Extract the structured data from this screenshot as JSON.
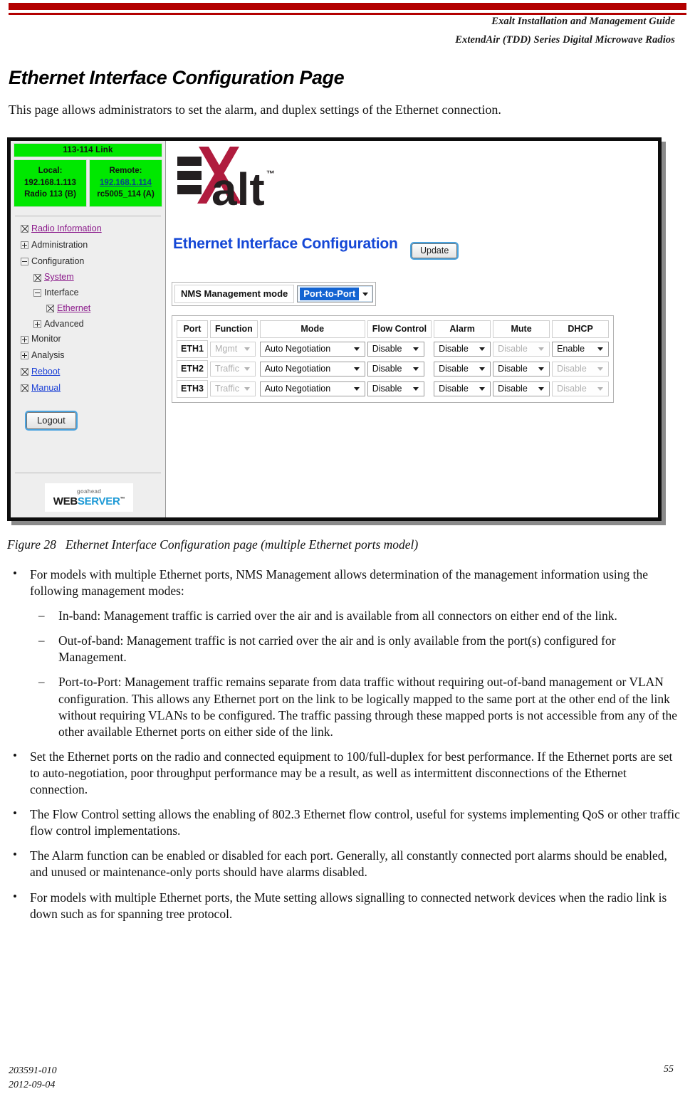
{
  "header": {
    "line1": "Exalt Installation and Management Guide",
    "line2": "ExtendAir (TDD) Series Digital Microwave Radios",
    "accent_color": "#b30000"
  },
  "section": {
    "title": "Ethernet Interface Configuration Page",
    "intro": "This page allows administrators to set the alarm, and duplex settings of the Ethernet connection."
  },
  "figure": {
    "caption_label": "Figure 28",
    "caption_text": "Ethernet Interface Configuration page (multiple Ethernet ports model)"
  },
  "webui": {
    "link_status": {
      "title": "113-114 Link",
      "local": {
        "label": "Local:",
        "ip": "192.168.1.113",
        "name": "Radio 113 (B)"
      },
      "remote": {
        "label": "Remote:",
        "ip": "192.168.1.114",
        "name": "rc5005_114 (A)"
      },
      "bg_color": "#00e800"
    },
    "nav": [
      {
        "label": "Radio Information",
        "icon": "cross-box-icon",
        "style": "visited",
        "level": 1
      },
      {
        "label": "Administration",
        "icon": "plus-box-icon",
        "style": "plain",
        "level": 1
      },
      {
        "label": "Configuration",
        "icon": "minus-box-icon",
        "style": "plain",
        "level": 1
      },
      {
        "label": "System",
        "icon": "cross-box-icon",
        "style": "visited",
        "level": 2
      },
      {
        "label": "Interface",
        "icon": "minus-box-icon",
        "style": "plain",
        "level": 2
      },
      {
        "label": "Ethernet",
        "icon": "cross-box-icon",
        "style": "visited",
        "level": 3
      },
      {
        "label": "Advanced",
        "icon": "plus-box-icon",
        "style": "plain",
        "level": 2
      },
      {
        "label": "Monitor",
        "icon": "plus-box-icon",
        "style": "plain",
        "level": 1
      },
      {
        "label": "Analysis",
        "icon": "plus-box-icon",
        "style": "plain",
        "level": 1
      },
      {
        "label": "Reboot",
        "icon": "cross-box-icon",
        "style": "blue",
        "level": 1
      },
      {
        "label": "Manual",
        "icon": "cross-box-icon",
        "style": "blue",
        "level": 1
      }
    ],
    "logout_label": "Logout",
    "brand": {
      "wordmark": "Exalt",
      "trademark": "TM"
    },
    "webserver_logo": {
      "top": "goahead",
      "word1": "WEB",
      "word2": "SERVER",
      "tm": "TM"
    },
    "page_title": "Ethernet Interface Configuration",
    "update_label": "Update",
    "nms": {
      "label": "NMS Management mode",
      "value": "Port-to-Port",
      "options": [
        "In-band",
        "Out-of-band",
        "Port-to-Port"
      ],
      "highlight_color": "#1464d2"
    },
    "table": {
      "columns": [
        "Port",
        "Function",
        "Mode",
        "Flow Control",
        "Alarm",
        "Mute",
        "DHCP"
      ],
      "rows": [
        {
          "port": "ETH1",
          "function": {
            "value": "Mgmt",
            "disabled": true
          },
          "mode": {
            "value": "Auto Negotiation",
            "disabled": false
          },
          "flow_control": {
            "value": "Disable",
            "disabled": false
          },
          "alarm": {
            "value": "Disable",
            "disabled": false
          },
          "mute": {
            "value": "Disable",
            "disabled": true
          },
          "dhcp": {
            "value": "Enable",
            "disabled": false
          }
        },
        {
          "port": "ETH2",
          "function": {
            "value": "Traffic",
            "disabled": true
          },
          "mode": {
            "value": "Auto Negotiation",
            "disabled": false
          },
          "flow_control": {
            "value": "Disable",
            "disabled": false
          },
          "alarm": {
            "value": "Disable",
            "disabled": false
          },
          "mute": {
            "value": "Disable",
            "disabled": false
          },
          "dhcp": {
            "value": "Disable",
            "disabled": true
          }
        },
        {
          "port": "ETH3",
          "function": {
            "value": "Traffic",
            "disabled": true
          },
          "mode": {
            "value": "Auto Negotiation",
            "disabled": false
          },
          "flow_control": {
            "value": "Disable",
            "disabled": false
          },
          "alarm": {
            "value": "Disable",
            "disabled": false
          },
          "mute": {
            "value": "Disable",
            "disabled": false
          },
          "dhcp": {
            "value": "Disable",
            "disabled": true
          }
        }
      ]
    }
  },
  "body": {
    "bullet1": "For models with multiple Ethernet ports, NMS Management allows determination of the management information using the following management modes:",
    "sub1": "In-band: Management traffic is carried over the air and is available from all connectors on either end of the link.",
    "sub2": "Out-of-band: Management traffic is not carried over the air and is only available from the port(s) configured for Management.",
    "sub3": "Port-to-Port: Management traffic remains separate from data traffic without requiring out-of-band management or VLAN configuration. This allows any Ethernet port on the link to be logically mapped to the same port at the other end of the link without requiring VLANs to be configured. The traffic passing through these mapped ports is not accessible from any of the other available Ethernet ports on either side of the link.",
    "bullet2": "Set the Ethernet ports on the radio and connected equipment to 100/full-duplex for best performance. If the Ethernet ports are set to auto-negotiation, poor throughput performance may be a result, as well as intermittent disconnections of the Ethernet connection.",
    "bullet3": "The Flow Control setting allows the enabling of 802.3 Ethernet flow control, useful for systems implementing QoS or other traffic flow control implementations.",
    "bullet4": "The Alarm function can be enabled or disabled for each port. Generally, all constantly connected port alarms should be enabled, and unused or maintenance-only ports should have alarms disabled.",
    "bullet5": "For models with multiple Ethernet ports, the Mute setting allows signalling to connected network devices when the radio link is down such as for spanning tree protocol.",
    "bullet_marker": "•",
    "dash_marker": "–"
  },
  "footer": {
    "doc_number": "203591-010",
    "doc_date": "2012-09-04",
    "page_number": "55"
  }
}
